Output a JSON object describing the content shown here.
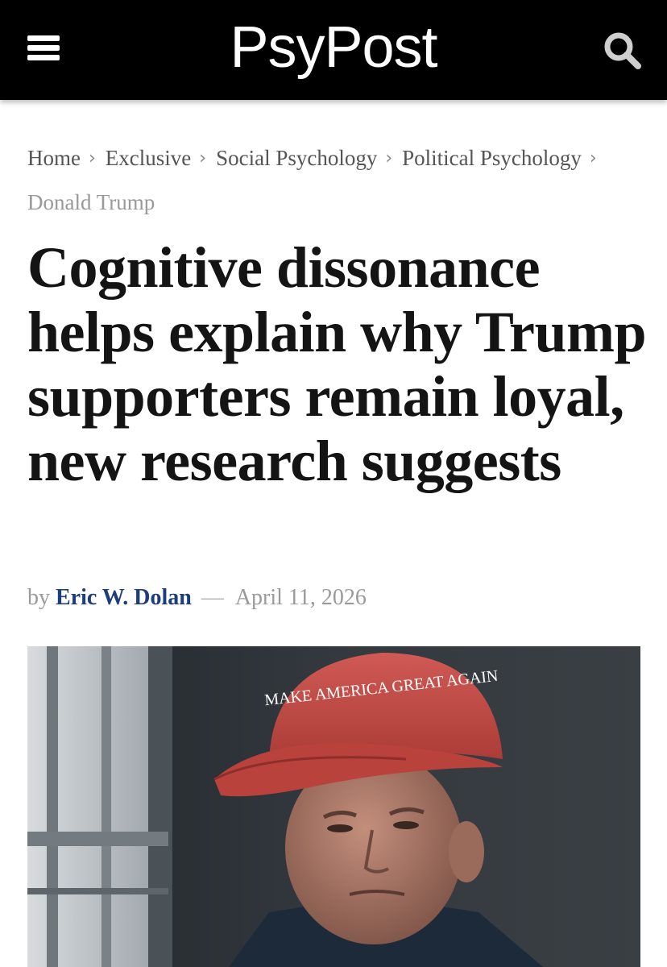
{
  "header": {
    "site_name": "PsyPost"
  },
  "breadcrumb": {
    "items": [
      "Home",
      "Exclusive",
      "Social Psychology",
      "Political Psychology"
    ],
    "separator": "›",
    "current": "Donald Trump"
  },
  "article": {
    "title": "Cognitive dissonance helps explain why Trump supporters remain loyal, new research suggests",
    "byline_prefix": "by",
    "author": "Eric W. Dolan",
    "byline_separator": "—",
    "date": "April 11, 2026"
  },
  "hero_image": {
    "cap_text": "MAKE AMERICA GREAT AGAIN"
  },
  "colors": {
    "header_bg": "#000000",
    "author_link": "#1d3e7c",
    "title_text": "#141414",
    "cap_red": "#c8453f"
  }
}
